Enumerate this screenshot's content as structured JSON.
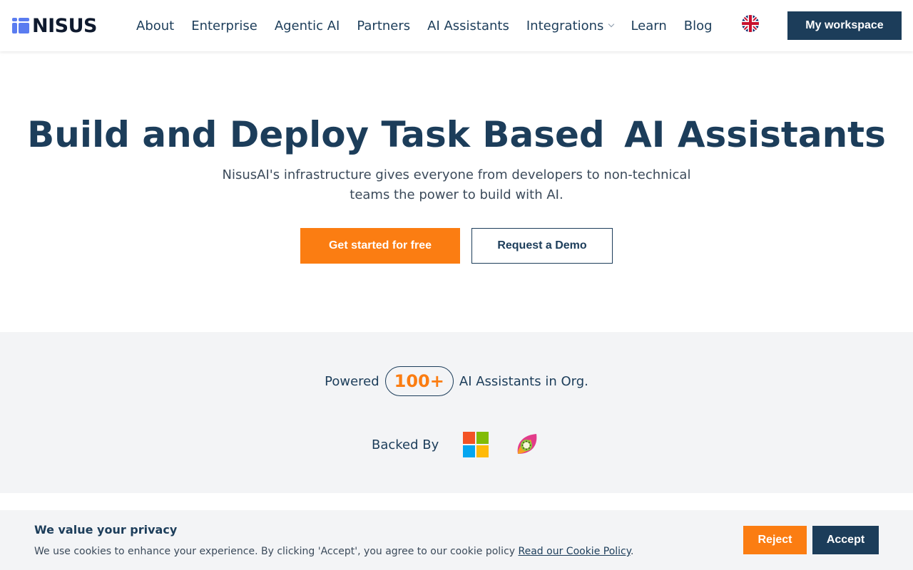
{
  "header": {
    "logo_text": "NISUS",
    "logo_icon": "nisus-logo-icon",
    "nav": [
      {
        "label": "About"
      },
      {
        "label": "Enterprise"
      },
      {
        "label": "Agentic AI"
      },
      {
        "label": "Partners"
      },
      {
        "label": "AI Assistants"
      },
      {
        "label": "Integrations",
        "has_dropdown": true
      },
      {
        "label": "Learn"
      },
      {
        "label": "Blog"
      }
    ],
    "language_icon": "uk-flag-icon",
    "workspace_label": "My workspace"
  },
  "hero": {
    "title_main": "Build and Deploy Task Based",
    "title_highlight": "AI Assistants",
    "subtitle": "NisusAI's infrastructure gives everyone from developers to non-technical teams the power to build with AI.",
    "primary_cta": "Get started for free",
    "secondary_cta": "Request a Demo"
  },
  "stats": {
    "prefix": "Powered",
    "count": "100+",
    "suffix": "AI Assistants in Org.",
    "backed_label": "Backed By",
    "backers": [
      "microsoft-logo-icon",
      "kiwi-logo-icon"
    ]
  },
  "cookie": {
    "title": "We value your privacy",
    "text": "We use cookies to enhance your experience. By clicking 'Accept', you agree to our cookie policy",
    "link": "Read our Cookie Policy",
    "period": ".",
    "reject_label": "Reject",
    "accept_label": "Accept"
  },
  "colors": {
    "navy": "#1c3d5a",
    "orange": "#fb7d12",
    "highlight": "#fde6d3",
    "band": "#f3f4f6"
  }
}
